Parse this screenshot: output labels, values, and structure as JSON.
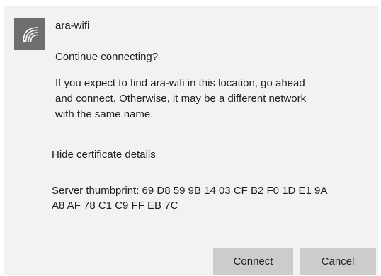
{
  "network": {
    "name": "ara-wifi",
    "icon": "wifi-signal-icon",
    "icon_tile_color": "#6e6e6e"
  },
  "dialog": {
    "prompt": "Continue connecting?",
    "body_line_1": "If you expect to find ara-wifi in this location, go ahead",
    "body_line_2": "and connect. Otherwise, it may be a different network",
    "body_line_3": "with the same name.",
    "cert_toggle_label": "Hide certificate details",
    "thumbprint_line_1": "Server thumbprint: 69 D8 59 9B 14 03 CF B2 F0 1D E1 9A",
    "thumbprint_line_2": "A8 AF 78 C1 C9 FF EB 7C"
  },
  "buttons": {
    "connect_label": "Connect",
    "cancel_label": "Cancel",
    "button_bg": "#cccccc"
  },
  "colors": {
    "dialog_bg": "#f2f2f2",
    "text": "#1f1f1f"
  }
}
